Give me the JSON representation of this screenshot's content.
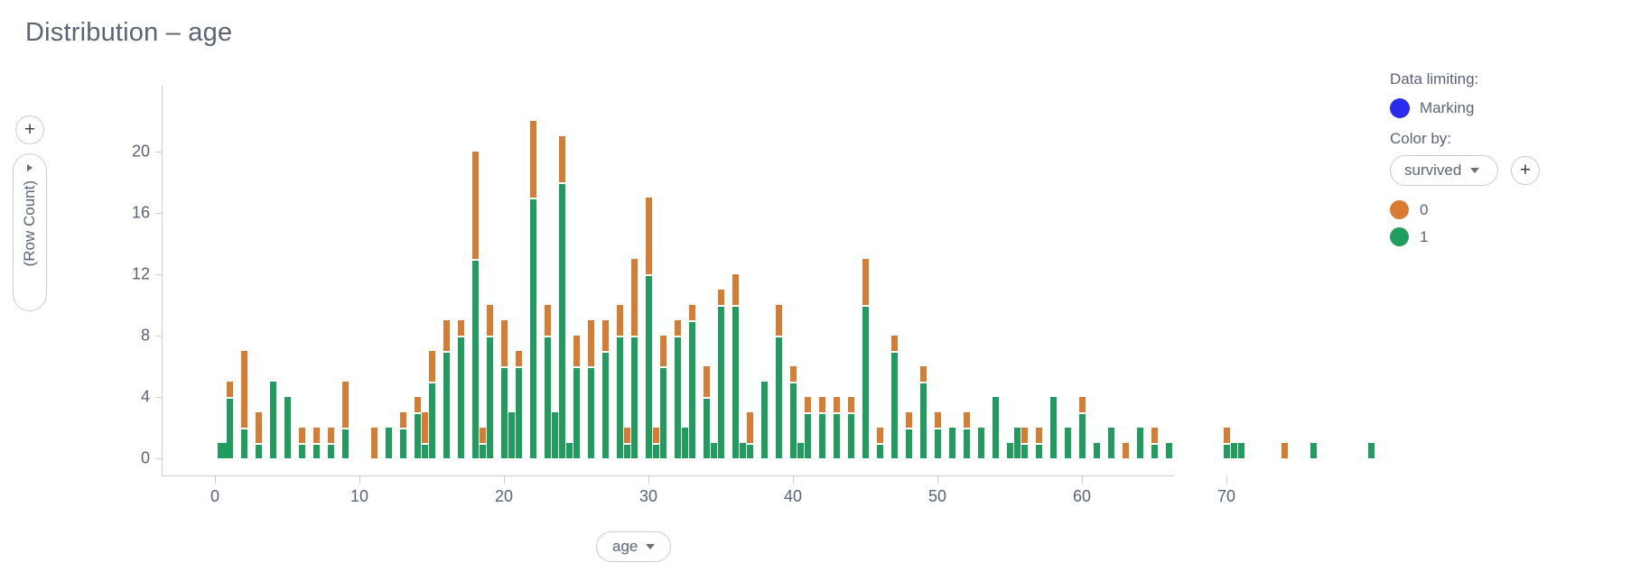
{
  "title": "Distribution – age",
  "y_axis": {
    "label": "(Row Count)",
    "plus_label": "+",
    "caret": "expand-caret"
  },
  "x_axis": {
    "selector_label": "age"
  },
  "panel": {
    "data_limiting_heading": "Data limiting:",
    "marking_label": "Marking",
    "marking_color": "#2b2bee",
    "color_by_heading": "Color by:",
    "color_by_value": "survived",
    "add_button_label": "+",
    "legend_items": [
      {
        "label": "0",
        "color": "#d97b30"
      },
      {
        "label": "1",
        "color": "#1e9d5c"
      }
    ]
  },
  "chart_data": {
    "type": "bar",
    "stacked": true,
    "title": "Distribution – age",
    "xlabel": "age",
    "ylabel": "(Row Count)",
    "xlim": [
      -1.5,
      78
    ],
    "ylim": [
      0,
      23
    ],
    "grid": false,
    "legend_position": "right",
    "colors": {
      "0": "#d97b30",
      "1": "#1e9d5c"
    },
    "series": [
      {
        "name": "0",
        "color": "#d97b30"
      },
      {
        "name": "1",
        "color": "#1e9d5c"
      }
    ],
    "x": [
      0.42,
      0.67,
      0.75,
      0.83,
      0.92,
      1,
      2,
      3,
      4,
      5,
      6,
      7,
      8,
      9,
      10,
      11,
      12,
      13,
      14,
      14.5,
      15,
      16,
      17,
      18,
      18.5,
      19,
      20,
      20.5,
      21,
      22,
      23,
      23.5,
      24,
      24.5,
      25,
      26,
      27,
      28,
      28.5,
      29,
      30,
      30.5,
      31,
      32,
      32.5,
      33,
      34,
      34.5,
      35,
      36,
      36.5,
      37,
      38,
      39,
      40,
      40.5,
      41,
      42,
      43,
      44,
      45,
      45.5,
      46,
      47,
      48,
      49,
      50,
      51,
      52,
      53,
      54,
      55,
      55.5,
      56,
      57,
      58,
      59,
      60,
      61,
      62,
      63,
      64,
      65,
      66,
      70,
      70.5,
      71,
      74,
      76,
      80
    ],
    "values_0": [
      0,
      0,
      0,
      0,
      0,
      1,
      5,
      2,
      0,
      0,
      1,
      1,
      1,
      3,
      0,
      2,
      0,
      1,
      1,
      2,
      2,
      2,
      1,
      7,
      1,
      2,
      3,
      0,
      1,
      5,
      2,
      0,
      3,
      0,
      2,
      3,
      2,
      2,
      1,
      5,
      5,
      1,
      2,
      1,
      0,
      1,
      2,
      0,
      1,
      2,
      0,
      2,
      0,
      2,
      1,
      0,
      1,
      1,
      1,
      1,
      3,
      0,
      1,
      1,
      1,
      1,
      1,
      0,
      1,
      0,
      0,
      0,
      0,
      1,
      1,
      0,
      0,
      1,
      0,
      0,
      1,
      0,
      1,
      0,
      1,
      0,
      0,
      1,
      0,
      0
    ],
    "values_1": [
      1,
      1,
      1,
      1,
      1,
      4,
      2,
      1,
      5,
      4,
      1,
      1,
      1,
      2,
      0,
      0,
      2,
      2,
      3,
      1,
      5,
      7,
      8,
      13,
      1,
      8,
      6,
      3,
      6,
      17,
      8,
      3,
      18,
      1,
      6,
      6,
      7,
      8,
      1,
      8,
      12,
      1,
      6,
      8,
      2,
      9,
      4,
      1,
      10,
      10,
      1,
      1,
      5,
      8,
      5,
      1,
      3,
      3,
      3,
      3,
      10,
      0,
      1,
      7,
      2,
      5,
      2,
      2,
      2,
      2,
      4,
      1,
      2,
      1,
      1,
      4,
      2,
      3,
      1,
      2,
      0,
      2,
      1,
      1,
      1,
      1,
      1,
      0,
      1,
      1
    ],
    "y_ticks": [
      0,
      4,
      8,
      12,
      16,
      20
    ],
    "x_ticks": [
      0,
      10,
      20,
      30,
      40,
      50,
      60,
      70
    ]
  }
}
